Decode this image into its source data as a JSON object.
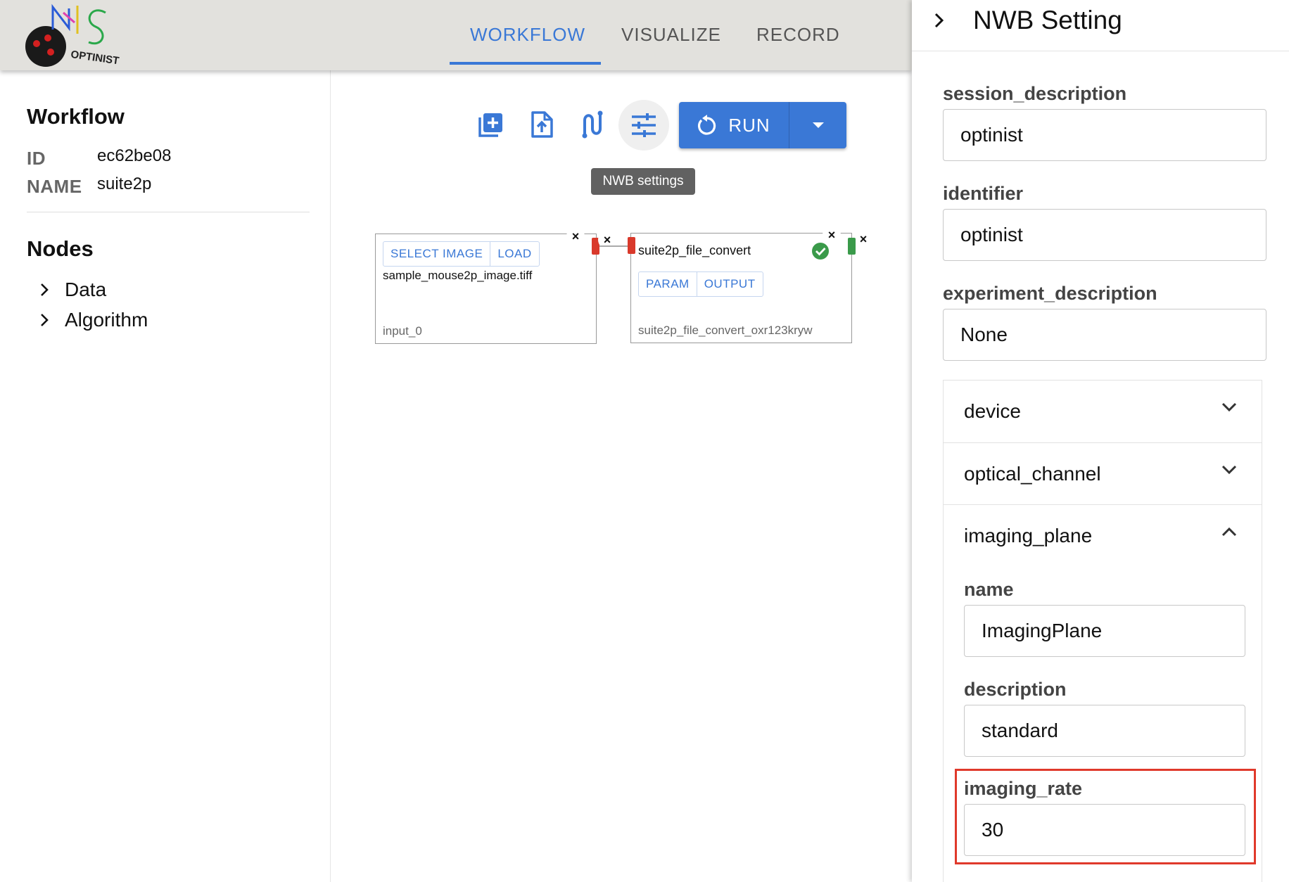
{
  "header": {
    "logo_text": "OPTINIST",
    "tabs": [
      {
        "label": "WORKFLOW",
        "active": true
      },
      {
        "label": "VISUALIZE",
        "active": false
      },
      {
        "label": "RECORD",
        "active": false
      }
    ],
    "accent_color": "#3a78d6"
  },
  "sidebar": {
    "workflow_title": "Workflow",
    "id_label": "ID",
    "id_value": "ec62be08",
    "name_label": "NAME",
    "name_value": "suite2p",
    "nodes_title": "Nodes",
    "tree": [
      {
        "label": "Data",
        "icon": "chevron-right-icon"
      },
      {
        "label": "Algorithm",
        "icon": "chevron-right-icon"
      }
    ]
  },
  "toolbar": {
    "icons": [
      "add-box-icon",
      "upload-file-icon",
      "route-icon",
      "tune-icon"
    ],
    "run_label": "RUN",
    "tooltip": "NWB settings"
  },
  "nodes": [
    {
      "buttons": [
        "SELECT IMAGE",
        "LOAD"
      ],
      "filename": "sample_mouse2p_image.tiff",
      "node_id": "input_0"
    },
    {
      "title": "suite2p_file_convert",
      "buttons": [
        "PARAM",
        "OUTPUT"
      ],
      "node_id": "suite2p_file_convert_oxr123kryw",
      "status": "success"
    }
  ],
  "nwb_panel": {
    "title": "NWB Setting",
    "fields": [
      {
        "label": "session_description",
        "value": "optinist"
      },
      {
        "label": "identifier",
        "value": "optinist"
      },
      {
        "label": "experiment_description",
        "value": "None"
      }
    ],
    "sections": [
      {
        "label": "device",
        "expanded": false
      },
      {
        "label": "optical_channel",
        "expanded": false
      },
      {
        "label": "imaging_plane",
        "expanded": true
      }
    ],
    "imaging_plane_fields": [
      {
        "label": "name",
        "value": "ImagingPlane"
      },
      {
        "label": "description",
        "value": "standard"
      },
      {
        "label": "imaging_rate",
        "value": "30"
      }
    ]
  }
}
